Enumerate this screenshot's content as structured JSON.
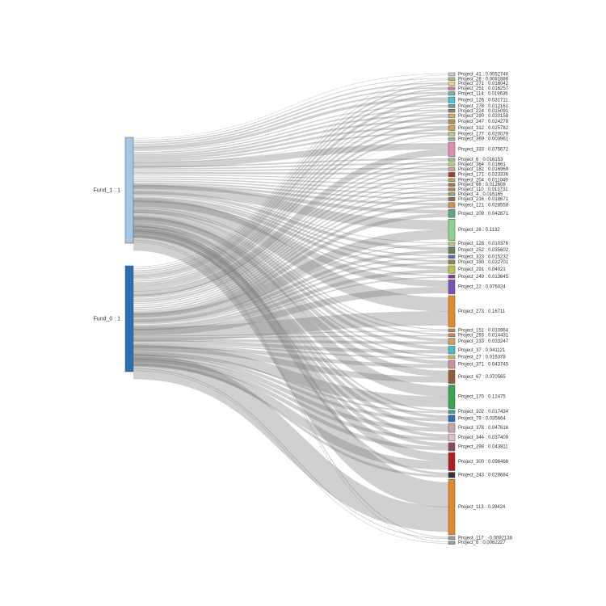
{
  "chart_data": {
    "type": "sankey",
    "sources": [
      {
        "id": "Fund_1",
        "label": "Fund_1 : 1",
        "value": 1,
        "color": "#a6c6e5"
      },
      {
        "id": "Fund_0",
        "label": "Fund_0 : 1",
        "value": 1,
        "color": "#2a6fb4"
      }
    ],
    "targets": [
      {
        "id": "Project_41",
        "label": "Project_41 : 0.0052746",
        "value": 0.0052746
      },
      {
        "id": "Project_28",
        "label": "Project_28 : 0.0081886",
        "value": 0.0081886
      },
      {
        "id": "Project_271",
        "label": "Project_271 : 0.016042",
        "value": 0.016042
      },
      {
        "id": "Project_251",
        "label": "Project_251 : 0.016257",
        "value": 0.016257
      },
      {
        "id": "Project_114",
        "label": "Project_114 : 0.019636",
        "value": 0.019636
      },
      {
        "id": "Project_126",
        "label": "Project_126 : 0.031711",
        "value": 0.031711
      },
      {
        "id": "Project_278",
        "label": "Project_278 : 0.012161",
        "value": 0.012161
      },
      {
        "id": "Project_224",
        "label": "Project_224 : 0.015091",
        "value": 0.015091
      },
      {
        "id": "Project_290",
        "label": "Project_290 : 0.020158",
        "value": 0.020158
      },
      {
        "id": "Project_247",
        "label": "Project_247 : 0.024278",
        "value": 0.024278
      },
      {
        "id": "Project_312",
        "label": "Project_312 : 0.025782",
        "value": 0.025782
      },
      {
        "id": "Project_177",
        "label": "Project_177 : 0.020079",
        "value": 0.020079
      },
      {
        "id": "Project_369",
        "label": "Project_369 : 0.003961",
        "value": 0.003961
      },
      {
        "id": "Project_333",
        "label": "Project_333 : 0.075672",
        "value": 0.075672
      },
      {
        "id": "Project_6",
        "label": "Project_6 : 0.016153",
        "value": 0.016153
      },
      {
        "id": "Project_364",
        "label": "Project_364 : 0.01661",
        "value": 0.01661
      },
      {
        "id": "Project_182",
        "label": "Project_182 : 0.016969",
        "value": 0.016969
      },
      {
        "id": "Project_171",
        "label": "Project_171 : 0.023336",
        "value": 0.023336
      },
      {
        "id": "Project_204",
        "label": "Project_204 : 0.011049",
        "value": 0.011049
      },
      {
        "id": "Project_66",
        "label": "Project_66 : 0.012608",
        "value": 0.012608
      },
      {
        "id": "Project_110",
        "label": "Project_110 : 0.013731",
        "value": 0.013731
      },
      {
        "id": "Project_4",
        "label": "Project_4 : 0.016165",
        "value": 0.016165
      },
      {
        "id": "Project_216",
        "label": "Project_216 : 0.018671",
        "value": 0.018671
      },
      {
        "id": "Project_121",
        "label": "Project_121 : 0.028558",
        "value": 0.028558
      },
      {
        "id": "Project_209",
        "label": "Project_209 : 0.042671",
        "value": 0.042671
      },
      {
        "id": "Project_26",
        "label": "Project_26 : 0.1132",
        "value": 0.1132
      },
      {
        "id": "Project_128",
        "label": "Project_128 : 0.010376",
        "value": 0.010376
      },
      {
        "id": "Project_252",
        "label": "Project_252 : 0.035602",
        "value": 0.035602
      },
      {
        "id": "Project_323",
        "label": "Project_323 : 0.015232",
        "value": 0.015232
      },
      {
        "id": "Project_330",
        "label": "Project_330 : 0.022701",
        "value": 0.022701
      },
      {
        "id": "Project_291",
        "label": "Project_291 : 0.04021",
        "value": 0.04021
      },
      {
        "id": "Project_249",
        "label": "Project_249 : 0.013645",
        "value": 0.013645
      },
      {
        "id": "Project_22",
        "label": "Project_22 : 0.076024",
        "value": 0.076024
      },
      {
        "id": "Project_273",
        "label": "Project_273 : 0.16711",
        "value": 0.16711
      },
      {
        "id": "Project_151",
        "label": "Project_151 : 0.010964",
        "value": 0.010964
      },
      {
        "id": "Project_293",
        "label": "Project_293 : 0.014431",
        "value": 0.014431
      },
      {
        "id": "Project_233",
        "label": "Project_233 : 0.033247",
        "value": 0.033247
      },
      {
        "id": "Project_37",
        "label": "Project_37 : 0.041121",
        "value": 0.041121
      },
      {
        "id": "Project_27",
        "label": "Project_27 : 0.016378",
        "value": 0.016378
      },
      {
        "id": "Project_371",
        "label": "Project_371 : 0.043745",
        "value": 0.043745
      },
      {
        "id": "Project_67",
        "label": "Project_67 : 0.070565",
        "value": 0.070565
      },
      {
        "id": "Project_170",
        "label": "Project_170 : 0.12475",
        "value": 0.12475
      },
      {
        "id": "Project_102",
        "label": "Project_102 : 0.017434",
        "value": 0.017434
      },
      {
        "id": "Project_79",
        "label": "Project_79 : 0.035664",
        "value": 0.035664
      },
      {
        "id": "Project_378",
        "label": "Project_378 : 0.047616",
        "value": 0.047616
      },
      {
        "id": "Project_344",
        "label": "Project_344 : 0.037409",
        "value": 0.037409
      },
      {
        "id": "Project_298",
        "label": "Project_298 : 0.043811",
        "value": 0.043811
      },
      {
        "id": "Project_300",
        "label": "Project_300 : 0.096466",
        "value": 0.096466
      },
      {
        "id": "Project_243",
        "label": "Project_243 : 0.028684",
        "value": 0.028684
      },
      {
        "id": "Project_113",
        "label": "Project_113 : 0.29424",
        "value": 0.29424
      },
      {
        "id": "Project_117",
        "label": "Project_117 : -0.0092138",
        "value": -0.0092138
      },
      {
        "id": "Project_8",
        "label": "Project_8 : 0.0062227",
        "value": 0.0062227
      }
    ],
    "target_colors": [
      "#cfcfcf",
      "#b7b482",
      "#e7d97d",
      "#d07e9a",
      "#6fb8a5",
      "#4cbfd8",
      "#52a88b",
      "#9b7a72",
      "#c9b36a",
      "#b58f5a",
      "#d79b59",
      "#bfbf87",
      "#9fb096",
      "#e28bb2",
      "#a0bc7e",
      "#c1c866",
      "#c7a68a",
      "#b03939",
      "#b8a45d",
      "#9c7a52",
      "#c07e42",
      "#a2a075",
      "#8b6e4a",
      "#d0924a",
      "#5fa688",
      "#8fd18f",
      "#b2c86c",
      "#6c7f54",
      "#4f6fa6",
      "#8c8c4c",
      "#c0bd4a",
      "#a12f8c",
      "#7a53b6",
      "#e18c2a",
      "#b78e4a",
      "#c6876a",
      "#cf9f5a",
      "#4fb8c7",
      "#c7c050",
      "#cf8f96",
      "#8b5f3a",
      "#38a651",
      "#3ca67d",
      "#2f6fb4",
      "#c6a6a6",
      "#e3bcc7",
      "#8c4a60",
      "#b01f1f",
      "#333333",
      "#e08a2a",
      "#9f9f9f",
      "#9f9f9f"
    ],
    "links": "each_source_to_all_targets"
  }
}
